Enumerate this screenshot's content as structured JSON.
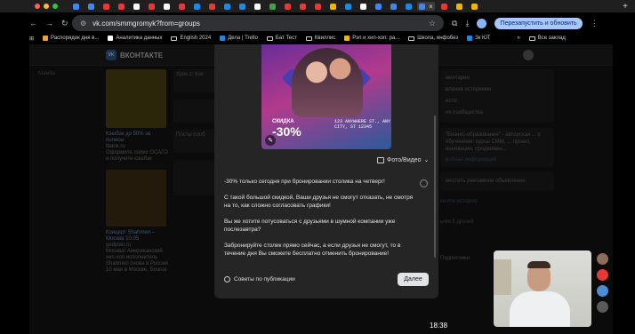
{
  "browser": {
    "url": "vk.com/smmgromyk?from=groups",
    "relaunch_label": "Перезапустить и обновить",
    "traffic_colors": [
      "#ff5f57",
      "#febc2e",
      "#28c840"
    ],
    "tab_favicon_colors": [
      "#4285f4",
      "#4285f4",
      "#e53935",
      "#e53935",
      "#ffffff",
      "#e53935",
      "#ffffff",
      "#e53935",
      "#1e88e5",
      "#e53935",
      "#1e88e5",
      "#1e88e5",
      "#ffffff",
      "#43a047",
      "#e53935",
      "#e53935",
      "#e53935",
      "#f4b400",
      "#1e88e5",
      "#ffffff",
      "#4285f4",
      "#4285f4",
      "#1e88e5",
      "#4285f4",
      "#e53935",
      "#f4b400",
      "#f4b400"
    ],
    "active_tab_close": "×",
    "new_tab": "+",
    "bookmarks": [
      {
        "label": "Распорядок дня в...",
        "color": "#e8a33d"
      },
      {
        "label": "Аналитика данных",
        "color": "#ffffff"
      },
      {
        "label": "English 2024",
        "color": "folder"
      },
      {
        "label": "Дела | Trello",
        "color": "#1e88e5"
      },
      {
        "label": "Бат Тест",
        "color": "folder"
      },
      {
        "label": "Квиллис",
        "color": "folder"
      },
      {
        "label": "Рэп и хип-хоп: ра...",
        "color": "#f4b400"
      },
      {
        "label": "Школа, инфобез",
        "color": "folder"
      },
      {
        "label": "Зк ЮТ",
        "color": "#1e88e5"
      }
    ],
    "bookmarks_overflow": "»",
    "all_bookmarks": "Все заклад"
  },
  "vk": {
    "logo_text": "ВКОНТАКТЕ",
    "logo_badge": "VK",
    "left_menu_item": "Мамба",
    "ads": [
      {
        "title": "Кэшбэк до 50% за полисы",
        "domain": "tbank.ru",
        "text": "Оформите полис ОСАГО и получите кэшбэк"
      },
      {
        "title": "Концерт Shahmen – Москва 10.05",
        "domain": "gedplan.ru",
        "text": "Москва! Американский хип-хоп исполнитель Shahmen снова в России 10 мая в Москве, Source"
      }
    ],
    "feed_snippets": [
      "Урок 1: Как",
      "Посты сооб"
    ],
    "side_items": [
      "ментарии",
      "вление историями",
      "ести",
      "ия сообщества"
    ],
    "side_block_text": "\"Бизнес-образование\" - авторская ... с обучением: курсы СММ, ... проект, инновации, продвижен...",
    "side_link": "робная информация",
    "promo_text": "местить рекламное объявление",
    "stories_link": "мните историю",
    "friends_title": "ыми 5 друзей",
    "subscribers": "Подписчики"
  },
  "modal": {
    "photo": {
      "discount_label": "СКИДКА",
      "discount": "-30%",
      "address": "123 ANYWHERE ST., ANY CITY, ST 12345"
    },
    "media_button": "Фото/Видео",
    "paragraphs": [
      "-30% только сегодня при бронировании столика на четверг!",
      "С такой большой скидкой, Ваши друзья не смогут отказать, не смотря на то, как сложно согласовать графики!",
      "Вы же хотите потусоваться с друзьями в шумной компании уже послезавтра?",
      "Забронируйте столик прямо сейчас, а если друзья не смогут, то в течение дня Вы сможете бесплатно отменить бронирование!"
    ],
    "tips_label": "Советы по публикации",
    "next_label": "Далее"
  },
  "overlay_time": "18:38",
  "notif_colors": [
    "#8a6d5a",
    "#e53935",
    "#4c8bd6",
    "#5a5a5a"
  ]
}
